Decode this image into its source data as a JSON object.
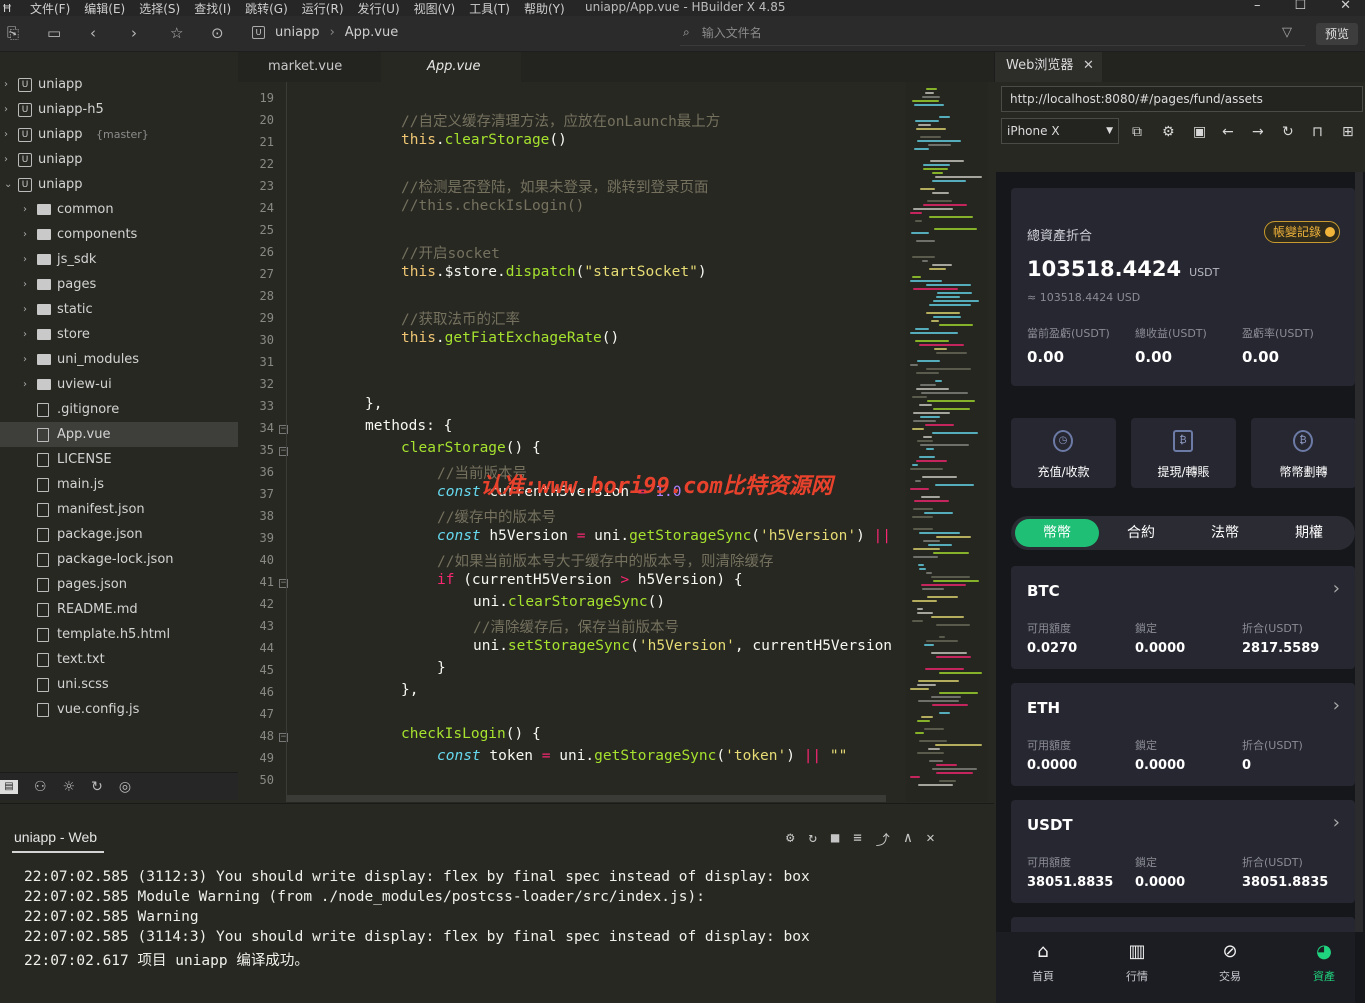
{
  "app": {
    "window_title": "uniapp/App.vue - HBuilder X 4.85",
    "menu": [
      "文件(F)",
      "编辑(E)",
      "选择(S)",
      "查找(I)",
      "跳转(G)",
      "运行(R)",
      "发行(U)",
      "视图(V)",
      "工具(T)",
      "帮助(Y)"
    ],
    "window_buttons": [
      "–",
      "☐",
      "✕"
    ]
  },
  "toolbar": {
    "breadcrumb": [
      "uniapp",
      "App.vue"
    ],
    "search_placeholder": "输入文件名",
    "preview_label": "预览"
  },
  "sidebar": {
    "items": [
      {
        "label": "uniapp",
        "type": "project",
        "expanded": false
      },
      {
        "label": "uniapp-h5",
        "type": "project",
        "expanded": false
      },
      {
        "label": "uniapp",
        "sub": "{master}",
        "type": "project",
        "expanded": false
      },
      {
        "label": "uniapp",
        "type": "project",
        "expanded": false
      },
      {
        "label": "uniapp",
        "type": "project",
        "expanded": true
      },
      {
        "label": "common",
        "type": "folder"
      },
      {
        "label": "components",
        "type": "folder"
      },
      {
        "label": "js_sdk",
        "type": "folder"
      },
      {
        "label": "pages",
        "type": "folder"
      },
      {
        "label": "static",
        "type": "folder"
      },
      {
        "label": "store",
        "type": "folder"
      },
      {
        "label": "uni_modules",
        "type": "folder"
      },
      {
        "label": "uview-ui",
        "type": "folder"
      },
      {
        "label": ".gitignore",
        "type": "file"
      },
      {
        "label": "App.vue",
        "type": "file",
        "selected": true
      },
      {
        "label": "LICENSE",
        "type": "file"
      },
      {
        "label": "main.js",
        "type": "file"
      },
      {
        "label": "manifest.json",
        "type": "file"
      },
      {
        "label": "package.json",
        "type": "file"
      },
      {
        "label": "package-lock.json",
        "type": "file"
      },
      {
        "label": "pages.json",
        "type": "file"
      },
      {
        "label": "README.md",
        "type": "file"
      },
      {
        "label": "template.h5.html",
        "type": "file"
      },
      {
        "label": "text.txt",
        "type": "file"
      },
      {
        "label": "uni.scss",
        "type": "file"
      },
      {
        "label": "vue.config.js",
        "type": "file"
      }
    ],
    "bottom_icons": [
      "files-icon",
      "debug-icon",
      "bug-icon",
      "plugin-icon",
      "globe-icon"
    ]
  },
  "editor": {
    "tabs": [
      "market.vue",
      "App.vue"
    ],
    "active_tab": "App.vue",
    "line_numbers": [
      "19",
      "20",
      "21",
      "22",
      "23",
      "24",
      "25",
      "26",
      "27",
      "28",
      "29",
      "30",
      "31",
      "32",
      "33",
      "34",
      "35",
      "36",
      "37",
      "38",
      "39",
      "40",
      "41",
      "42",
      "43",
      "44",
      "45",
      "46",
      "47",
      "48",
      "49",
      "50"
    ],
    "lines": {
      "l20": "//自定义缓存清理方法，应放在onLaunch最上方",
      "l21a": "this",
      "l21b": ".",
      "l21c": "clearStorage",
      "l21d": "()",
      "l23": "//检测是否登陆，如果未登录，跳转到登录页面",
      "l24": "//this.checkIsLogin()",
      "l26": "//开启socket",
      "l27a": "this",
      "l27b": ".$store.",
      "l27c": "dispatch",
      "l27d": "(",
      "l27e": "\"startSocket\"",
      "l27f": ")",
      "l29": "//获取法币的汇率",
      "l30a": "this",
      "l30b": ".",
      "l30c": "getFiatExchageRate",
      "l30d": "()",
      "l33": "},",
      "l34": "methods: {",
      "l35a": "clearStorage",
      "l35b": "() {",
      "l36": "//当前版本号",
      "l37a": "const",
      "l37b": " currentH5Version ",
      "l37c": "=",
      "l37d": " 1.0",
      "l38": "//缓存中的版本号",
      "l39a": "const",
      "l39b": " h5Version ",
      "l39c": "=",
      "l39d": " uni.",
      "l39e": "getStorageSync",
      "l39f": "(",
      "l39g": "'h5Version'",
      "l39h": ") ",
      "l39i": "||",
      "l40": "//如果当前版本号大于缓存中的版本号，则清除缓存",
      "l41a": "if",
      "l41b": " (currentH5Version ",
      "l41c": ">",
      "l41d": " h5Version) {",
      "l42a": "uni.",
      "l42b": "clearStorageSync",
      "l42c": "()",
      "l43": "//清除缓存后，保存当前版本号",
      "l44a": "uni.",
      "l44b": "setStorageSync",
      "l44c": "(",
      "l44d": "'h5Version'",
      "l44e": ", currentH5Version",
      "l45": "}",
      "l46": "},",
      "l48a": "checkIsLogin",
      "l48b": "() {",
      "l49a": "const",
      "l49b": " token ",
      "l49c": "=",
      "l49d": " uni.",
      "l49e": "getStorageSync",
      "l49f": "(",
      "l49g": "'token'",
      "l49h": ") ",
      "l49i": "||",
      "l49j": " \"\""
    },
    "watermark": "认准:www.bori99.com比特资源网"
  },
  "console": {
    "title": "uniapp - Web",
    "lines": [
      "22:07:02.585 (3112:3) You should write display: flex by final spec instead of display: box",
      "22:07:02.585 Module Warning (from ./node_modules/postcss-loader/src/index.js):",
      "22:07:02.585 Warning",
      "22:07:02.585 (3114:3) You should write display: flex by final spec instead of display: box",
      "22:07:02.617 项目 uniapp 编译成功。"
    ]
  },
  "browser": {
    "tab_label": "Web浏览器",
    "url": "http://localhost:8080/#/pages/fund/assets",
    "device": "iPhone X"
  },
  "phone": {
    "assets_title": "總資產折合",
    "badge": "帳變記錄",
    "total_value": "103518.4424",
    "total_unit": "USDT",
    "approx": "≈ 103518.4424 USD",
    "stats": [
      {
        "label": "當前盈虧(USDT)",
        "value": "0.00"
      },
      {
        "label": "總收益(USDT)",
        "value": "0.00"
      },
      {
        "label": "盈虧率(USDT)",
        "value": "0.00"
      }
    ],
    "actions": [
      "充值/收款",
      "提現/轉賬",
      "幣幣劃轉"
    ],
    "segments": [
      "幣幣",
      "合約",
      "法幣",
      "期權"
    ],
    "coins": [
      {
        "name": "BTC",
        "labels": [
          "可用額度",
          "鎖定",
          "折合(USDT)"
        ],
        "values": [
          "0.0270",
          "0.0000",
          "2817.5589"
        ]
      },
      {
        "name": "ETH",
        "labels": [
          "可用額度",
          "鎖定",
          "折合(USDT)"
        ],
        "values": [
          "0.0000",
          "0.0000",
          "0"
        ]
      },
      {
        "name": "USDT",
        "labels": [
          "可用額度",
          "鎖定",
          "折合(USDT)"
        ],
        "values": [
          "38051.8835",
          "0.0000",
          "38051.8835"
        ]
      }
    ],
    "tabbar": [
      "首頁",
      "行情",
      "交易",
      "資產"
    ],
    "active_tab": "資產"
  }
}
